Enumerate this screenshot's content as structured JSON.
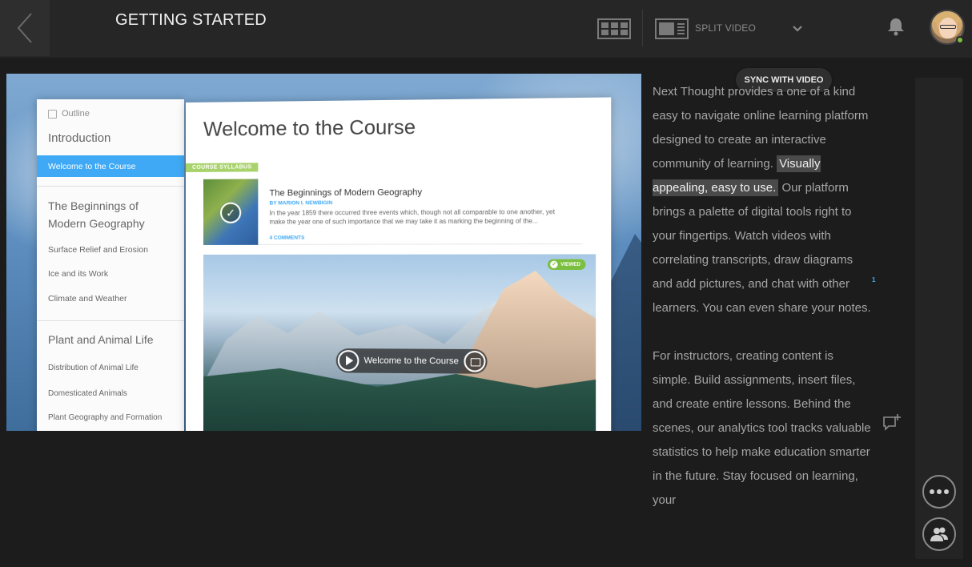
{
  "header": {
    "title": "GETTING STARTED",
    "split_video_label": "SPLIT VIDEO",
    "icons": [
      "back-chevron-icon",
      "grid-view-icon",
      "split-video-icon",
      "chevron-down-icon",
      "bell-icon"
    ]
  },
  "colors": {
    "accent_blue": "#3fa9f5",
    "accent_green": "#7bbf3e",
    "background": "#1c1c1c",
    "topbar": "#262626"
  },
  "video": {
    "outline": {
      "heading": "Outline",
      "items": [
        {
          "label": "Introduction",
          "type": "section"
        },
        {
          "label": "Welcome to the Course",
          "type": "lesson",
          "active": true
        },
        {
          "label": "The Beginnings of Modern Geography",
          "type": "section"
        },
        {
          "label": "Surface Relief and Erosion",
          "type": "lesson"
        },
        {
          "label": "Ice and its Work",
          "type": "lesson"
        },
        {
          "label": "Climate and Weather",
          "type": "lesson"
        },
        {
          "label": "Plant and Animal Life",
          "type": "section"
        },
        {
          "label": "Distribution of Animal Life",
          "type": "lesson"
        },
        {
          "label": "Domesticated Animals",
          "type": "lesson"
        },
        {
          "label": "Plant Geography and Formation",
          "type": "lesson"
        }
      ]
    },
    "course": {
      "title": "Welcome to the Course",
      "tag": "COURSE SYLLABUS",
      "card": {
        "title": "The Beginnings of Modern Geography",
        "author": "BY MARION I. NEWBIGIN",
        "description": "In the year 1859 there occurred three events which, though not all comparable to one another, yet make the year one of such importance that we may take it as marking the beginning of the...",
        "comments": "4 COMMENTS"
      },
      "viewed_label": "VIEWED",
      "video_label": "Welcome to the Course"
    }
  },
  "sync_label": "SYNC WITH VIDEO",
  "transcript": {
    "p1_a": "Next Thought provides a one of a kind  easy to navigate online learning platform  designed to create an interactive community of learning.",
    "p1_highlight": "Visually appealing, easy to use.",
    "p1_b": "Our platform brings a palette of digital tools  right to your fingertips.  Watch videos with correlating transcripts,  draw diagrams and add pictures,  and chat with other learners.  You can even share your notes.",
    "p2": "For instructors, creating content is simple.  Build assignments,  insert files,  and create entire lessons.  Behind the scenes, our analytics tool  tracks valuable statistics to help make  education smarter in the future.  Stay focused on learning, your",
    "note_count": "1"
  },
  "rail": {
    "icons": [
      "more-options-icon",
      "contacts-icon"
    ]
  }
}
